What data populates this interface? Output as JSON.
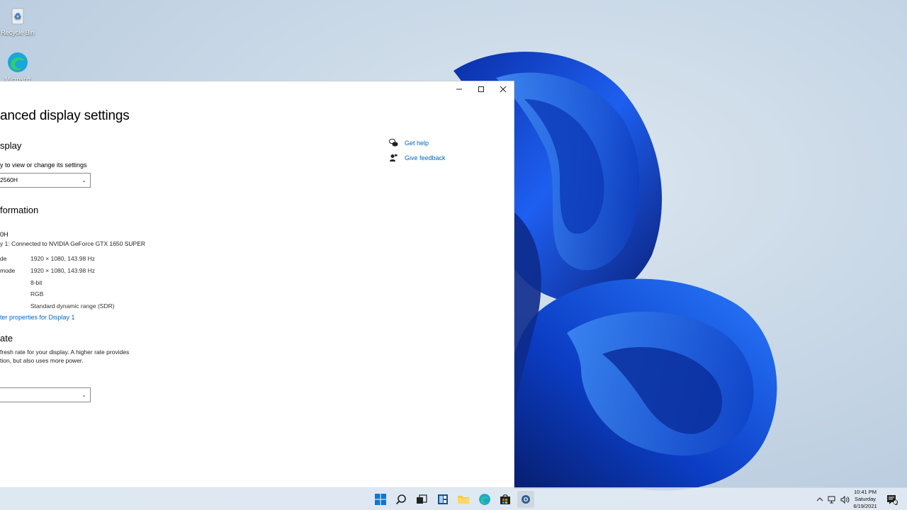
{
  "desktop": {
    "recycle_bin_label": "Recycle Bin",
    "edge_label": "Microsoft"
  },
  "window": {
    "title": "anced display settings",
    "section_display": "splay",
    "select_display_prompt": "y to view or change its settings",
    "display_select_value": "2560H",
    "section_info": "formation",
    "monitor_name": "0H",
    "connection": "y 1: Connected to NVIDIA GeForce GTX 1650 SUPER",
    "info_rows": [
      {
        "label": "de",
        "value": "1920 × 1080, 143.98 Hz"
      },
      {
        "label": "mode",
        "value": "1920 × 1080, 143.98 Hz"
      },
      {
        "label": "",
        "value": "8-bit"
      },
      {
        "label": "",
        "value": "RGB"
      },
      {
        "label": "",
        "value": "Standard dynamic range (SDR)"
      }
    ],
    "adapter_link": "ter properties for Display 1",
    "section_refresh": "ate",
    "refresh_desc_1": "fresh rate for your display. A higher rate provides",
    "refresh_desc_2": "tion, but also uses more power.",
    "refresh_select_value": "",
    "help": {
      "get_help": "Get help",
      "give_feedback": "Give feedback"
    }
  },
  "taskbar": {
    "time": "10:41 PM",
    "day": "Saturday",
    "date": "6/19/2021",
    "notification_count": "2"
  },
  "colors": {
    "accent": "#0067c0",
    "bloom": "#1a4fd6"
  }
}
